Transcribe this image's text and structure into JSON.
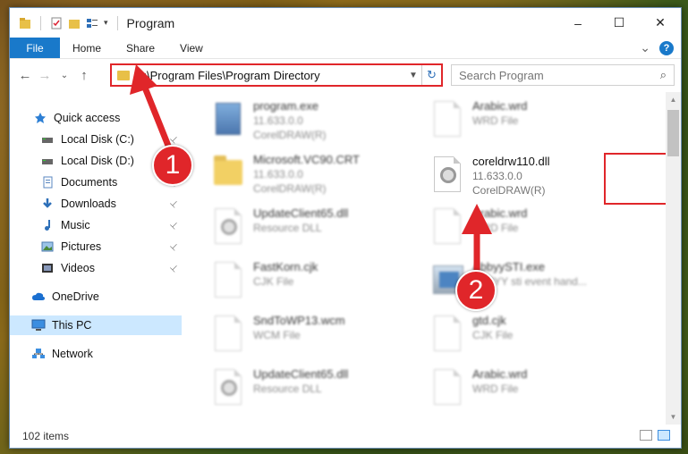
{
  "window": {
    "title": "Program",
    "controls": {
      "minimize": "–",
      "maximize": "☐",
      "close": "✕"
    }
  },
  "ribbon": {
    "file": "File",
    "tabs": [
      "Home",
      "Share",
      "View"
    ],
    "expand": "⌄",
    "help": "?"
  },
  "nav": {
    "back": "←",
    "forward": "→",
    "recent": "⌄",
    "up": "↑",
    "address": "C:\\Program Files\\Program Directory",
    "search_placeholder": "Search Program"
  },
  "sidebar": {
    "items": [
      {
        "label": "Quick access",
        "icon": "star-icon",
        "pinned": false
      },
      {
        "label": "Local Disk (C:)",
        "icon": "drive-icon",
        "pinned": true
      },
      {
        "label": "Local Disk (D:)",
        "icon": "drive-icon",
        "pinned": true
      },
      {
        "label": "Documents",
        "icon": "documents-icon",
        "pinned": true
      },
      {
        "label": "Downloads",
        "icon": "download-icon",
        "pinned": true
      },
      {
        "label": "Music",
        "icon": "music-icon",
        "pinned": true
      },
      {
        "label": "Pictures",
        "icon": "pictures-icon",
        "pinned": true
      },
      {
        "label": "Videos",
        "icon": "videos-icon",
        "pinned": true
      },
      {
        "label": "OneDrive",
        "icon": "cloud-icon",
        "pinned": false
      },
      {
        "label": "This PC",
        "icon": "computer-icon",
        "pinned": false,
        "selected": true
      },
      {
        "label": "Network",
        "icon": "network-icon",
        "pinned": false
      }
    ]
  },
  "files": [
    {
      "name": "program.exe",
      "sub1": "11.633.0.0",
      "sub2": "CorelDRAW(R)",
      "icon": "exe"
    },
    {
      "name": "Arabic.wrd",
      "sub1": "WRD File",
      "sub2": "",
      "icon": "doc"
    },
    {
      "name": "Microsoft.VC90.CRT",
      "sub1": "11.633.0.0",
      "sub2": "CorelDRAW(R)",
      "icon": "folder"
    },
    {
      "name": "coreldrw110.dll",
      "sub1": "11.633.0.0",
      "sub2": "CorelDRAW(R)",
      "icon": "gear"
    },
    {
      "name": "UpdateClient65.dll",
      "sub1": "Resource DLL",
      "sub2": "",
      "icon": "gear"
    },
    {
      "name": "Arabic.wrd",
      "sub1": "WRD File",
      "sub2": "",
      "icon": "doc"
    },
    {
      "name": "FastKorn.cjk",
      "sub1": "CJK File",
      "sub2": "",
      "icon": "doc"
    },
    {
      "name": "AbbyySTI.exe",
      "sub1": "ABBYY sti event hand...",
      "sub2": "",
      "icon": "exe2"
    },
    {
      "name": "SndToWP13.wcm",
      "sub1": "WCM File",
      "sub2": "",
      "icon": "doc"
    },
    {
      "name": "gtd.cjk",
      "sub1": "CJK File",
      "sub2": "",
      "icon": "doc"
    },
    {
      "name": "UpdateClient65.dll",
      "sub1": "Resource DLL",
      "sub2": "",
      "icon": "gear"
    },
    {
      "name": "Arabic.wrd",
      "sub1": "WRD File",
      "sub2": "",
      "icon": "doc"
    }
  ],
  "status": {
    "count": "102 items"
  },
  "annotations": {
    "step1": "1",
    "step2": "2",
    "color": "#e0262a"
  }
}
